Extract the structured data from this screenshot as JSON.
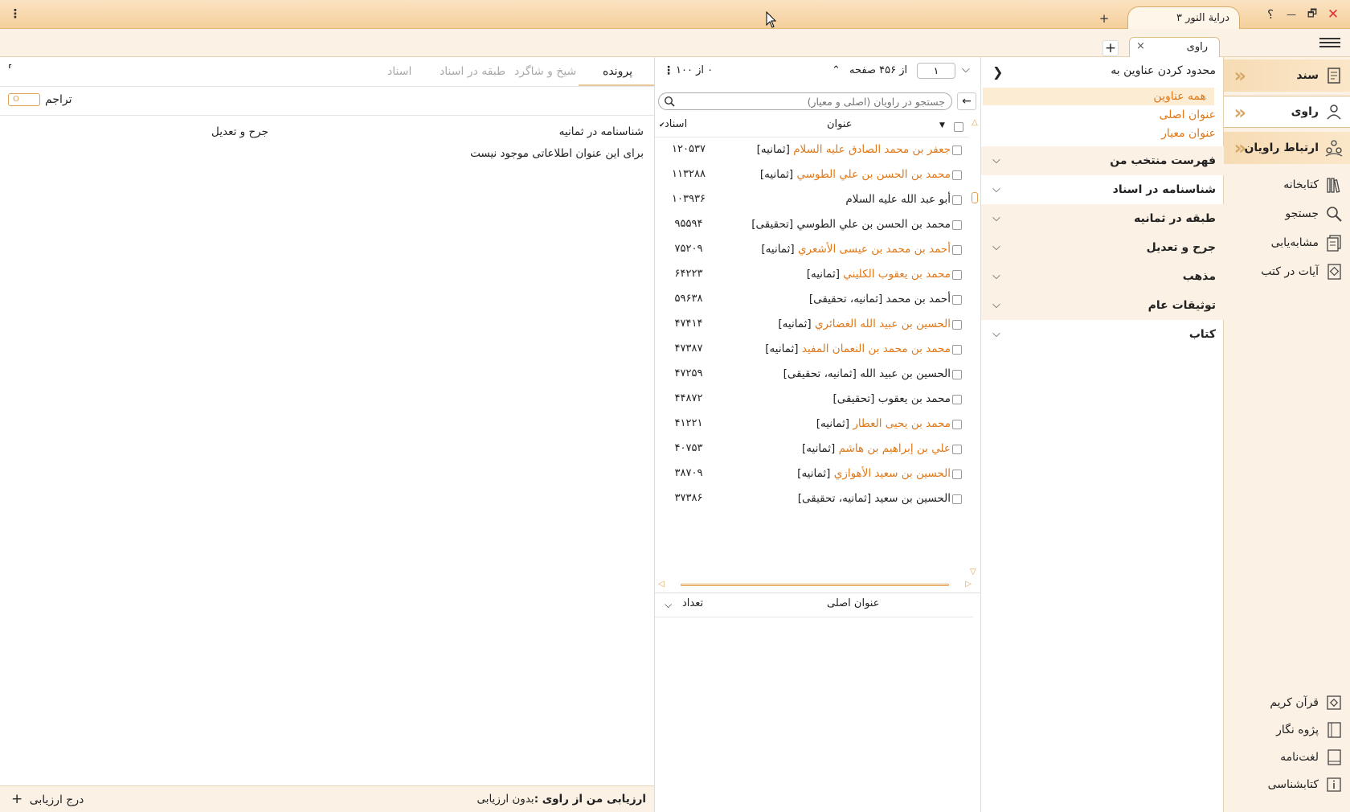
{
  "window": {
    "app_tab_title": "درایة النور ۳",
    "new_tab": "+",
    "help": "؟",
    "minimize": "—",
    "maximize": "🗗",
    "close": "✕",
    "kebab": "⋮"
  },
  "tabs": {
    "active_label": "راوی",
    "close": "×",
    "add": "+"
  },
  "nav": {
    "main": [
      {
        "label": "سند",
        "icon": "document-icon"
      },
      {
        "label": "راوی",
        "icon": "person-icon"
      },
      {
        "label": "ارتباط راویان",
        "icon": "people-network-icon"
      }
    ],
    "tools": [
      {
        "label": "کتابخانه",
        "icon": "bookshelf-icon"
      },
      {
        "label": "جستجو",
        "icon": "search-icon"
      },
      {
        "label": "مشابه‌یابی",
        "icon": "similar-docs-icon"
      },
      {
        "label": "آیات در کتب",
        "icon": "verses-book-icon"
      }
    ],
    "bottom": [
      {
        "label": "قرآن کریم",
        "icon": "quran-icon"
      },
      {
        "label": "پژوه نگار",
        "icon": "notebook-icon"
      },
      {
        "label": "لغت‌نامه",
        "icon": "dictionary-icon"
      },
      {
        "label": "کتابشناسی",
        "icon": "info-book-icon"
      }
    ]
  },
  "filter": {
    "header": "محدود کردن عناوین به",
    "options": [
      "همه عناوین",
      "عنوان اصلی",
      "عنوان معیار"
    ],
    "sections": [
      {
        "label": "فهرست منتخب من",
        "tint": true
      },
      {
        "label": "شناسنامه در اسناد",
        "tint": false
      },
      {
        "label": "طبقه در ثمانیه",
        "tint": true
      },
      {
        "label": "جرح و تعدیل",
        "tint": true
      },
      {
        "label": "مذهب",
        "tint": true
      },
      {
        "label": "توثیقات عام",
        "tint": true
      },
      {
        "label": "کتاب",
        "tint": false
      }
    ]
  },
  "list": {
    "selected_count": "۰ از ۱۰۰",
    "page_input": "۱",
    "page_total": "از ۴۵۶ صفحه",
    "search_placeholder": "جستجو در راویان (اصلی و معیار)",
    "col_title": "عنوان",
    "col_count": "اسناد",
    "rows": [
      {
        "main": "جعفر بن محمد الصادق علیه السلام",
        "tag": "[ثمانیه]",
        "count": "۱۲۰۵۳۷",
        "orange": true
      },
      {
        "main": "محمد بن الحسن بن علي الطوسي",
        "tag": "[ثمانیه]",
        "count": "۱۱۳۲۸۸",
        "orange": true
      },
      {
        "main": "أبو عبد الله علیه السلام",
        "tag": "",
        "count": "۱۰۳۹۳۶",
        "orange": false
      },
      {
        "main": "محمد بن الحسن بن علي الطوسي",
        "tag": "[تحقیقی]",
        "count": "۹۵۵۹۴",
        "orange": false
      },
      {
        "main": "أحمد بن محمد بن عیسی الأشعري",
        "tag": "[ثمانیه]",
        "count": "۷۵۲۰۹",
        "orange": true
      },
      {
        "main": "محمد بن یعقوب الکلیني",
        "tag": "[ثمانیه]",
        "count": "۶۴۲۲۳",
        "orange": true
      },
      {
        "main": "أحمد بن محمد",
        "tag": "[ثمانیه، تحقیقی]",
        "count": "۵۹۶۳۸",
        "orange": false
      },
      {
        "main": "الحسین بن عبید الله الغضائري",
        "tag": "[ثمانیه]",
        "count": "۴۷۴۱۴",
        "orange": true
      },
      {
        "main": "محمد بن محمد بن النعمان المفید",
        "tag": "[ثمانیه]",
        "count": "۴۷۳۸۷",
        "orange": true
      },
      {
        "main": "الحسین بن عبید الله",
        "tag": "[ثمانیه، تحقیقی]",
        "count": "۴۷۲۵۹",
        "orange": false
      },
      {
        "main": "محمد بن یعقوب",
        "tag": "[تحقیقی]",
        "count": "۴۴۸۷۲",
        "orange": false
      },
      {
        "main": "محمد بن یحیی العطار",
        "tag": "[ثمانیه]",
        "count": "۴۱۲۲۱",
        "orange": true
      },
      {
        "main": "علي بن إبراهیم بن هاشم",
        "tag": "[ثمانیه]",
        "count": "۴۰۷۵۳",
        "orange": true
      },
      {
        "main": "الحسین بن سعید الأهوازي",
        "tag": "[ثمانیه]",
        "count": "۳۸۷۰۹",
        "orange": true
      },
      {
        "main": "الحسین بن سعید",
        "tag": "[ثمانیه، تحقیقی]",
        "count": "۳۷۳۸۶",
        "orange": false
      }
    ],
    "lower_col_title": "عنوان اصلی",
    "lower_col_count": "تعداد"
  },
  "detail": {
    "tabs": [
      "پرونده",
      "شیخ و شاگرد",
      "طبقه در اسناد",
      "اسناد"
    ],
    "toggle_label": "تراجم",
    "toggle_state": "O",
    "identity_title": "شناسنامه در ثمانیه",
    "identity_empty": "برای این عنوان اطلاعاتی موجود نیست",
    "jarh_title": "جرح و تعدیل",
    "eval_label": "ارزیابی من از راوی :",
    "eval_value": "بدون ارزیابی",
    "add_eval": "درج ارزیابی",
    "add_icon": "+"
  }
}
